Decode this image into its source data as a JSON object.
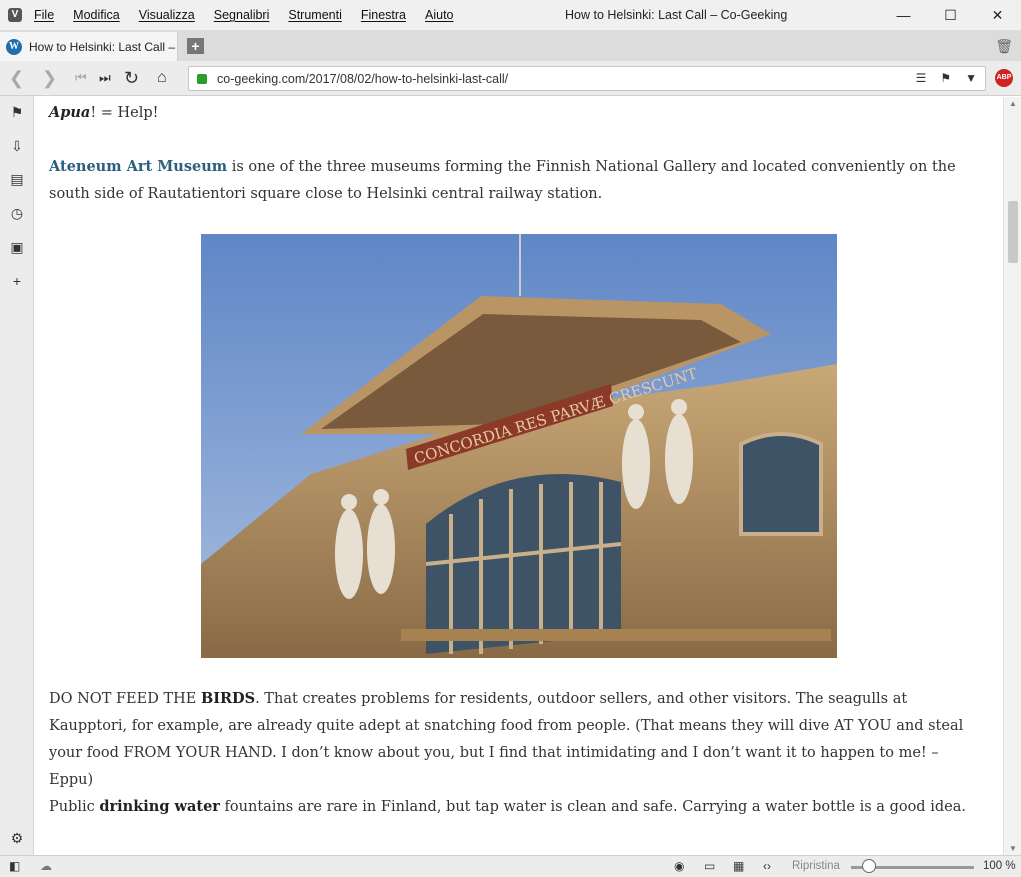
{
  "menu": [
    "File",
    "Modifica",
    "Visualizza",
    "Segnalibri",
    "Strumenti",
    "Finestra",
    "Aiuto"
  ],
  "window_title": "How to Helsinki: Last Call – Co-Geeking",
  "tab": {
    "title": "How to Helsinki: Last Call –"
  },
  "address": {
    "url": "co-geeking.com/2017/08/02/how-to-helsinki-last-call/",
    "adblock": "ABP"
  },
  "content": {
    "p0": {
      "word": "Apua",
      "rest": "! = Help!"
    },
    "p1": {
      "link": "Ateneum Art Museum",
      "text": " is one of the three museums forming the Finnish National Gallery and located conveniently on the south side of Rautatientori square close to Helsinki central railway station."
    },
    "p2": {
      "pre": "DO NOT FEED THE ",
      "bold": "BIRDS",
      "text": ". That creates problems for residents, outdoor sellers, and other visitors. The seagulls at Kaupptori, for example, are already quite adept at snatching food from people. (That means they will dive AT YOU and steal your food FROM YOUR HAND. I don’t know about you, but I find that intimidating and I don’t want it to happen to me! –Eppu)"
    },
    "p3": {
      "pre": "Public ",
      "bold": "drinking water",
      "text": " fountains are rare in Finland, but tap water is clean and safe. Carrying a water bottle is a good idea."
    },
    "photo_caption_text": "CONCORDIA RES PARVÆ CRESCUNT"
  },
  "statusbar": {
    "reset_label": "Ripristina",
    "zoom": "100 %",
    "zoom_fraction": 0.15
  },
  "colors": {
    "link": "#2a5f7f",
    "abp": "#d12222",
    "lock": "#2a9d2a"
  }
}
